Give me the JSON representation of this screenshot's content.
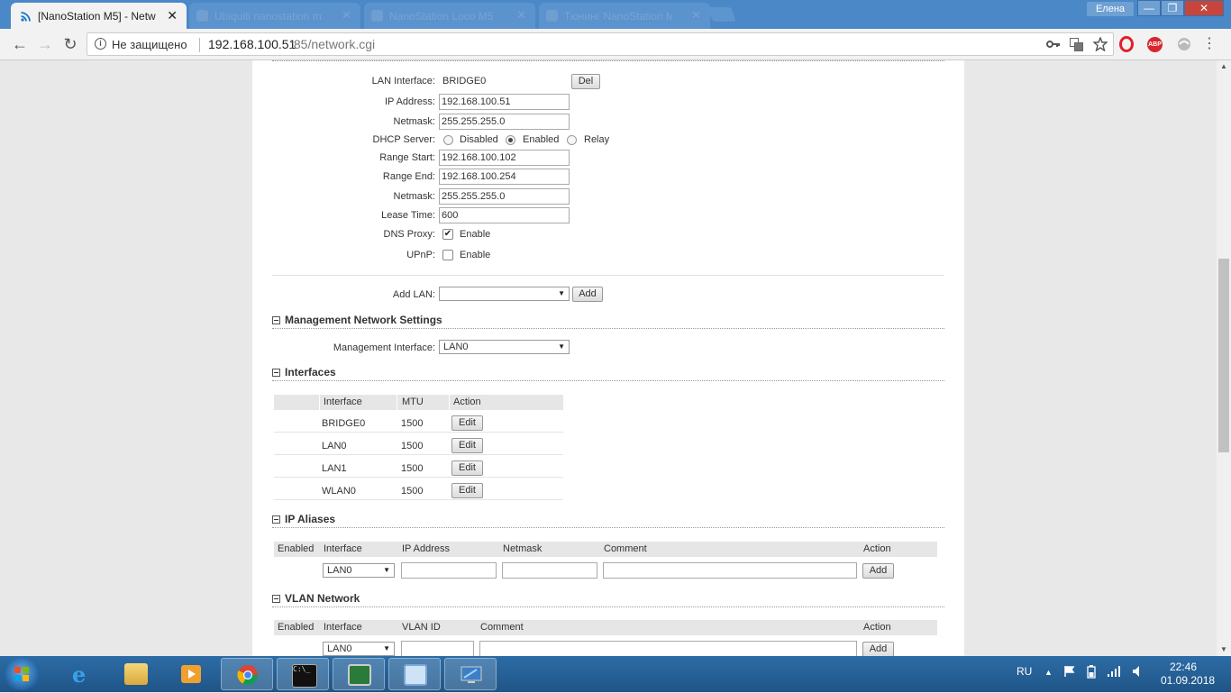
{
  "browser": {
    "tabs": [
      {
        "title": "[NanoStation M5] - Netw",
        "active": true
      },
      {
        "title": "Ubiquiti nanostation m2 настро",
        "active": false
      },
      {
        "title": "NanoStation Loco M5 |",
        "active": false
      },
      {
        "title": "Тюнинг NanoStation M5?",
        "active": false
      }
    ],
    "user": "Елена",
    "window_buttons": {
      "minimize": "—",
      "maximize": "❐",
      "close": "✕"
    },
    "nav": {
      "back": "←",
      "forward": "→",
      "reload": "↻"
    },
    "address": {
      "security_text": "Не защищено",
      "url_host": "192.168.100.51",
      "url_rest": ":85/network.cgi"
    },
    "toolbar_icons": [
      "key-icon",
      "translate-icon",
      "star-icon",
      "opera-icon",
      "adblock-icon",
      "extension-icon",
      "menu-icon"
    ],
    "adblock_label": "ABP",
    "menu_glyph": "⋮"
  },
  "lan": {
    "interface_label": "LAN Interface:",
    "interface_value": "BRIDGE0",
    "del_button": "Del",
    "ip_label": "IP Address:",
    "ip_value": "192.168.100.51",
    "netmask_label": "Netmask:",
    "netmask_value": "255.255.255.0",
    "dhcp_label": "DHCP Server:",
    "dhcp_options": [
      "Disabled",
      "Enabled",
      "Relay"
    ],
    "dhcp_selected": "Enabled",
    "range_start_label": "Range Start:",
    "range_start_value": "192.168.100.102",
    "range_end_label": "Range End:",
    "range_end_value": "192.168.100.254",
    "netmask2_label": "Netmask:",
    "netmask2_value": "255.255.255.0",
    "lease_label": "Lease Time:",
    "lease_value": "600",
    "dns_label": "DNS Proxy:",
    "dns_text": "Enable",
    "dns_checked": true,
    "upnp_label": "UPnP:",
    "upnp_text": "Enable",
    "upnp_checked": false,
    "add_lan_label": "Add LAN:",
    "add_lan_value": "",
    "add_button": "Add"
  },
  "management": {
    "title": "Management Network Settings",
    "iface_label": "Management Interface:",
    "iface_value": "LAN0"
  },
  "interfaces": {
    "title": "Interfaces",
    "columns": [
      "Interface",
      "MTU",
      "Action"
    ],
    "rows": [
      {
        "name": "BRIDGE0",
        "mtu": "1500",
        "action": "Edit"
      },
      {
        "name": "LAN0",
        "mtu": "1500",
        "action": "Edit"
      },
      {
        "name": "LAN1",
        "mtu": "1500",
        "action": "Edit"
      },
      {
        "name": "WLAN0",
        "mtu": "1500",
        "action": "Edit"
      }
    ]
  },
  "ip_aliases": {
    "title": "IP Aliases",
    "columns": [
      "Enabled",
      "Interface",
      "IP Address",
      "Netmask",
      "Comment",
      "Action"
    ],
    "iface_value": "LAN0",
    "add_button": "Add"
  },
  "vlan": {
    "title": "VLAN Network",
    "columns": [
      "Enabled",
      "Interface",
      "VLAN ID",
      "Comment",
      "Action"
    ],
    "iface_value": "LAN0",
    "add_button": "Add"
  },
  "taskbar": {
    "lang": "RU",
    "time": "22:46",
    "date": "01.09.2018"
  }
}
